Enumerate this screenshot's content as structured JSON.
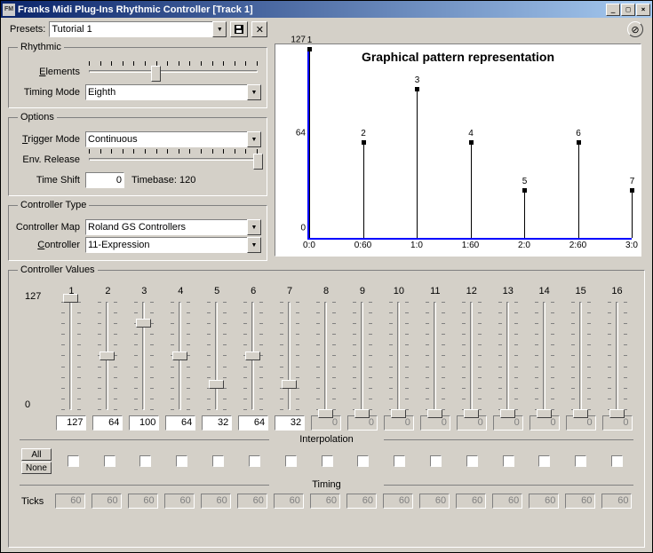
{
  "window": {
    "title": "Franks Midi Plug-Ins Rhythmic Controller [Track 1]"
  },
  "presets": {
    "label": "Presets:",
    "value": "Tutorial 1"
  },
  "rhythmic": {
    "legend": "Rhythmic",
    "elements_label": "Elements",
    "elements_value": 7,
    "elements_min": 1,
    "elements_max": 16,
    "timing_mode_label": "Timing Mode",
    "timing_mode_value": "Eighth"
  },
  "options": {
    "legend": "Options",
    "trigger_mode_label": "Trigger Mode",
    "trigger_mode_value": "Continuous",
    "env_release_label": "Env. Release",
    "env_release_value": 127,
    "time_shift_label": "Time Shift",
    "time_shift_value": "0",
    "timebase_label": "Timebase: 120"
  },
  "controller_type": {
    "legend": "Controller Type",
    "map_label": "Controller Map",
    "map_value": "Roland GS Controllers",
    "controller_label": "Controller",
    "controller_value": "11-Expression"
  },
  "chart_data": {
    "type": "stem",
    "title": "Graphical pattern representation",
    "categories": [
      "0:0",
      "0:60",
      "1:0",
      "1:60",
      "2:0",
      "2:60",
      "3:0"
    ],
    "values": [
      127,
      64,
      100,
      64,
      32,
      64,
      32
    ],
    "labels": [
      "1",
      "2",
      "3",
      "4",
      "5",
      "6",
      "7"
    ],
    "ylim": [
      0,
      127
    ],
    "yticks": [
      0,
      64,
      127
    ]
  },
  "controller_values": {
    "legend": "Controller Values",
    "y_axis": {
      "min": "0",
      "max": "127"
    },
    "channels": [
      1,
      2,
      3,
      4,
      5,
      6,
      7,
      8,
      9,
      10,
      11,
      12,
      13,
      14,
      15,
      16
    ],
    "values": [
      127,
      64,
      100,
      64,
      32,
      64,
      32,
      0,
      0,
      0,
      0,
      0,
      0,
      0,
      0,
      0
    ],
    "enabled_count": 7
  },
  "interpolation": {
    "legend": "Interpolation",
    "all_label": "All",
    "none_label": "None",
    "checks": [
      false,
      false,
      false,
      false,
      false,
      false,
      false,
      false,
      false,
      false,
      false,
      false,
      false,
      false,
      false,
      false
    ]
  },
  "timing": {
    "legend": "Timing",
    "label": "Ticks",
    "values": [
      60,
      60,
      60,
      60,
      60,
      60,
      60,
      60,
      60,
      60,
      60,
      60,
      60,
      60,
      60,
      60
    ]
  }
}
